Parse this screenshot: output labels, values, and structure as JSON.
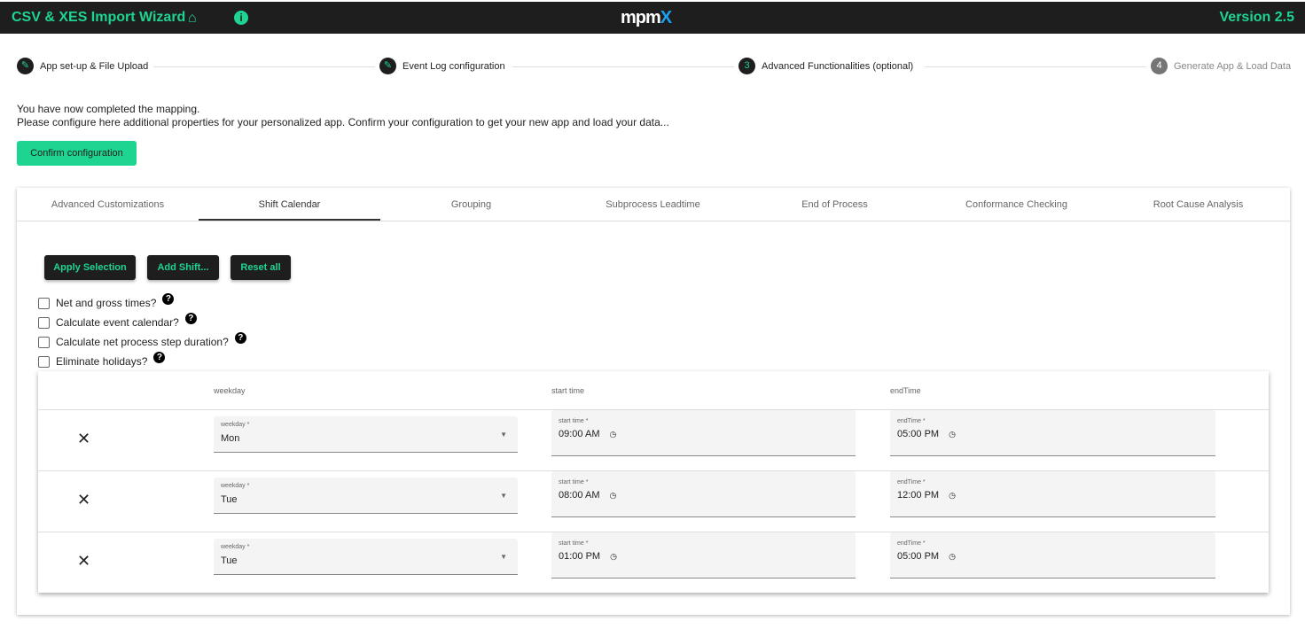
{
  "header": {
    "title": "CSV & XES Import Wizard",
    "home_icon": "home-icon",
    "info_icon": "info-icon",
    "logo": "mpmX",
    "version": "Version 2.5",
    "accent": "#1ed491"
  },
  "stepper": [
    {
      "num": "✎",
      "label": "App set-up & File Upload",
      "state": "done"
    },
    {
      "num": "✎",
      "label": "Event Log configuration",
      "state": "done"
    },
    {
      "num": "3",
      "label": "Advanced Functionalities (optional)",
      "state": "active"
    },
    {
      "num": "4",
      "label": "Generate App & Load Data",
      "state": "inactive"
    }
  ],
  "message": {
    "line1": "You have now completed the mapping.",
    "line2": "Please configure here additional properties for your personalized app. Confirm your configuration to get your new app and load your data..."
  },
  "confirm_label": "Confirm configuration",
  "tabs": [
    "Advanced Customizations",
    "Shift Calendar",
    "Grouping",
    "Subprocess Leadtime",
    "End of Process",
    "Conformance Checking",
    "Root Cause Analysis"
  ],
  "active_tab": "Shift Calendar",
  "actions": {
    "apply": "Apply Selection",
    "add": "Add Shift...",
    "reset": "Reset all"
  },
  "options": [
    {
      "label": "Net and gross times?",
      "checked": false
    },
    {
      "label": "Calculate event calendar?",
      "checked": false
    },
    {
      "label": "Calculate net process step duration?",
      "checked": false
    },
    {
      "label": "Eliminate holidays?",
      "checked": false
    }
  ],
  "table": {
    "headers": [
      "weekday",
      "start time",
      "endTime"
    ],
    "field_labels": {
      "weekday": "weekday *",
      "start": "start time *",
      "end": "endTime *"
    },
    "rows": [
      {
        "weekday": "Mon",
        "start": "09:00 AM",
        "end": "05:00 PM"
      },
      {
        "weekday": "Tue",
        "start": "08:00 AM",
        "end": "12:00 PM"
      },
      {
        "weekday": "Tue",
        "start": "01:00 PM",
        "end": "05:00 PM"
      }
    ]
  }
}
